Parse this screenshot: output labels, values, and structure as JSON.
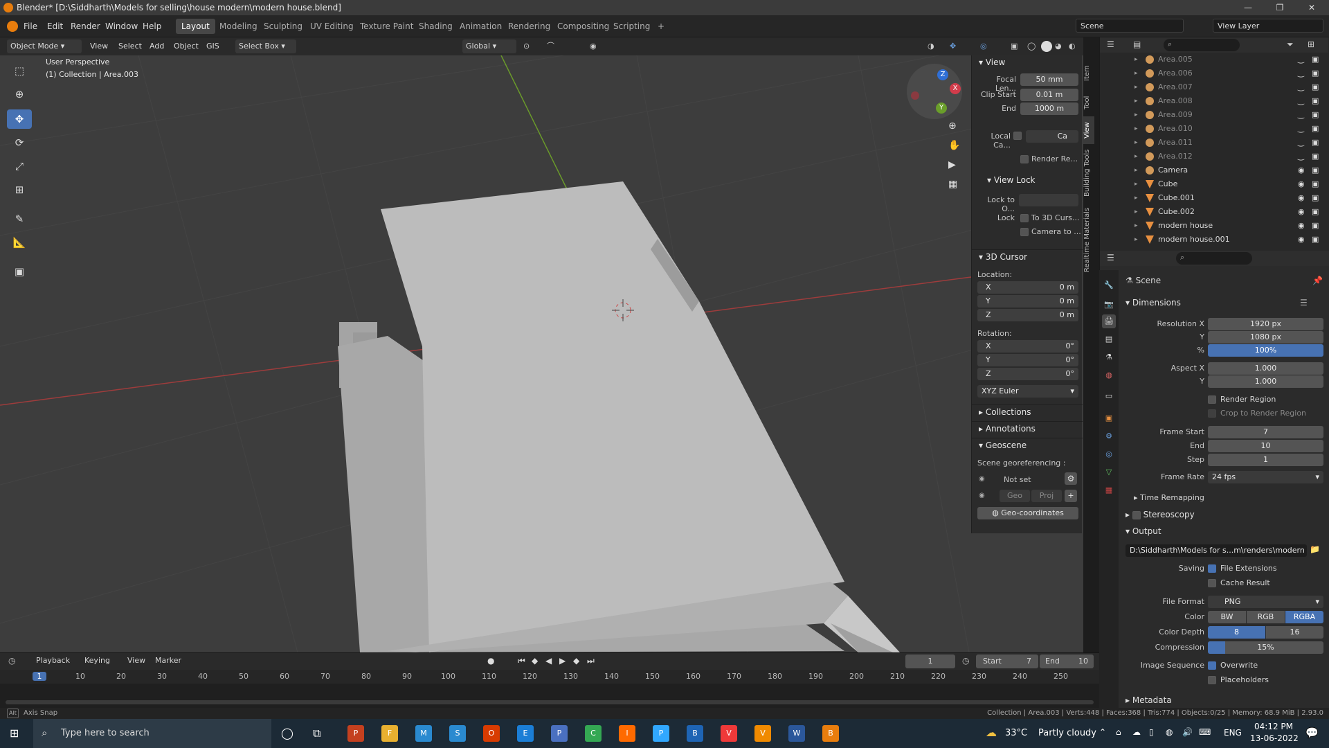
{
  "window": {
    "title": "Blender* [D:\\Siddharth\\Models for selling\\house modern\\modern house.blend]",
    "minimize": "—",
    "maximize": "❐",
    "close": "✕"
  },
  "menu": [
    "File",
    "Edit",
    "Render",
    "Window",
    "Help"
  ],
  "workspaces": [
    "Layout",
    "Modeling",
    "Sculpting",
    "UV Editing",
    "Texture Paint",
    "Shading",
    "Animation",
    "Rendering",
    "Compositing",
    "Scripting"
  ],
  "workspace_add": "+",
  "scene_name": "Scene",
  "view_layer": "View Layer",
  "vp_header": {
    "mode": "Object Mode",
    "view": "View",
    "select": "Select",
    "add": "Add",
    "object": "Object",
    "gis": "GIS",
    "select_box": "Select Box",
    "transform_orientation": "Global"
  },
  "viewport": {
    "perspective": "User Perspective",
    "collection_info": "(1) Collection | Area.003",
    "gizmo_x": "X",
    "gizmo_y": "Y",
    "gizmo_z": "Z"
  },
  "npanel": {
    "view_section": "View",
    "focal_length_label": "Focal Len...",
    "focal_length": "50 mm",
    "clip_start_label": "Clip Start",
    "clip_start": "0.01 m",
    "clip_end_label": "End",
    "clip_end": "1000 m",
    "local_camera_label": "Local Ca...",
    "local_camera_value": "Ca",
    "render_region": "Render Re...",
    "view_lock_section": "View Lock",
    "lock_to_object_label": "Lock to O...",
    "lock_label": "Lock",
    "lock_to_cursor": "To 3D Curs...",
    "camera_to_view": "Camera to ...",
    "cursor_section": "3D Cursor",
    "location_label": "Location:",
    "loc": [
      {
        "axis": "X",
        "value": "0 m"
      },
      {
        "axis": "Y",
        "value": "0 m"
      },
      {
        "axis": "Z",
        "value": "0 m"
      }
    ],
    "rotation_label": "Rotation:",
    "rot": [
      {
        "axis": "X",
        "value": "0°"
      },
      {
        "axis": "Y",
        "value": "0°"
      },
      {
        "axis": "Z",
        "value": "0°"
      }
    ],
    "rotation_mode": "XYZ Euler",
    "collections": "Collections",
    "annotations": "Annotations",
    "geoscene": "Geoscene",
    "scene_georef_label": "Scene georeferencing :",
    "not_set": "Not set",
    "geo": "Geo",
    "proj": "Proj",
    "geo_coordinates": "Geo-coordinates",
    "tabs": [
      "Item",
      "Tool",
      "View",
      "Building Tools",
      "Realtime Materials"
    ]
  },
  "outliner": {
    "rows": [
      {
        "name": "Area.005",
        "dim": true,
        "kind": "light"
      },
      {
        "name": "Area.006",
        "dim": true,
        "kind": "light"
      },
      {
        "name": "Area.007",
        "dim": true,
        "kind": "light"
      },
      {
        "name": "Area.008",
        "dim": true,
        "kind": "light"
      },
      {
        "name": "Area.009",
        "dim": true,
        "kind": "light"
      },
      {
        "name": "Area.010",
        "dim": true,
        "kind": "light"
      },
      {
        "name": "Area.011",
        "dim": true,
        "kind": "light"
      },
      {
        "name": "Area.012",
        "dim": true,
        "kind": "light"
      },
      {
        "name": "Camera",
        "dim": false,
        "kind": "camera"
      },
      {
        "name": "Cube",
        "dim": false,
        "kind": "mesh"
      },
      {
        "name": "Cube.001",
        "dim": false,
        "kind": "mesh"
      },
      {
        "name": "Cube.002",
        "dim": false,
        "kind": "mesh"
      },
      {
        "name": "modern house",
        "dim": false,
        "kind": "mesh"
      },
      {
        "name": "modern house.001",
        "dim": false,
        "kind": "mesh"
      }
    ]
  },
  "properties": {
    "scene": "Scene",
    "dimensions": "Dimensions",
    "res_x_label": "Resolution X",
    "res_x": "1920 px",
    "res_y_label": "Y",
    "res_y": "1080 px",
    "res_pct_label": "%",
    "res_pct": "100%",
    "aspect_x_label": "Aspect X",
    "aspect_x": "1.000",
    "aspect_y_label": "Y",
    "aspect_y": "1.000",
    "render_region": "Render Region",
    "crop_region": "Crop to Render Region",
    "frame_start_label": "Frame Start",
    "frame_start": "7",
    "frame_end_label": "End",
    "frame_end": "10",
    "frame_step_label": "Step",
    "frame_step": "1",
    "frame_rate_label": "Frame Rate",
    "frame_rate": "24 fps",
    "time_remapping": "Time Remapping",
    "stereoscopy": "Stereoscopy",
    "output": "Output",
    "output_path": "D:\\Siddharth\\Models for s...m\\renders\\modern house",
    "saving_label": "Saving",
    "file_extensions": "File Extensions",
    "cache_result": "Cache Result",
    "file_format_label": "File Format",
    "file_format": "PNG",
    "color_label": "Color",
    "color_bw": "BW",
    "color_rgb": "RGB",
    "color_rgba": "RGBA",
    "color_depth_label": "Color Depth",
    "depth_8": "8",
    "depth_16": "16",
    "compression_label": "Compression",
    "compression": "15%",
    "compression_fraction": 0.15,
    "image_sequence_label": "Image Sequence",
    "overwrite": "Overwrite",
    "placeholders": "Placeholders",
    "metadata": "Metadata"
  },
  "timeline": {
    "playback": "Playback",
    "keying": "Keying",
    "view": "View",
    "marker": "Marker",
    "current_frame": "1",
    "start_label": "Start",
    "start": "7",
    "end_label": "End",
    "end": "10",
    "ruler": [
      "1",
      "10",
      "20",
      "30",
      "40",
      "50",
      "60",
      "70",
      "80",
      "90",
      "100",
      "110",
      "120",
      "130",
      "140",
      "150",
      "160",
      "170",
      "180",
      "190",
      "200",
      "210",
      "220",
      "230",
      "240",
      "250"
    ]
  },
  "statusbar": {
    "left": "Axis Snap",
    "right": "Collection | Area.003 | Verts:448 | Faces:368 | Tris:774 | Objects:0/25 | Memory: 68.9 MiB | 2.93.0"
  },
  "taskbar": {
    "search_placeholder": "Type here to search",
    "weather_temp": "33°C",
    "weather_text": "Partly cloudy",
    "lang": "ENG",
    "time": "04:12 PM",
    "date": "13-06-2022",
    "apps": [
      "PowerPoint",
      "File Explorer",
      "Mail",
      "Store",
      "Office",
      "Edge",
      "Photos",
      "Chrome",
      "Illustrator",
      "Photoshop",
      "Bluetooth",
      "Vivaldi",
      "VLC",
      "Word",
      "Blender"
    ]
  }
}
